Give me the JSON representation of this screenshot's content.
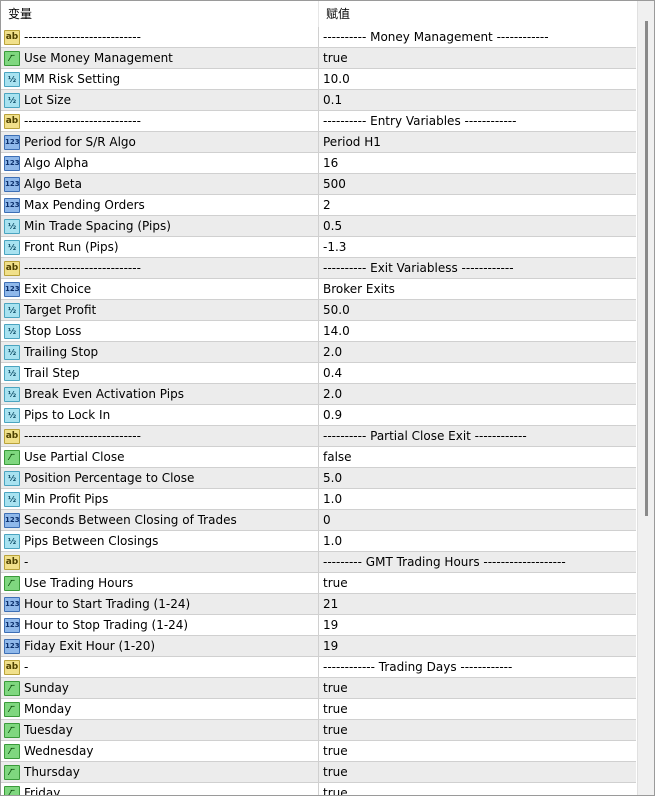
{
  "header": {
    "col_name": "变量",
    "col_value": "赋值"
  },
  "icon_labels": {
    "ab": "ab",
    "bool": "⁄‾",
    "dbl": "½",
    "int": "123"
  },
  "rows": [
    {
      "type": "ab",
      "name": "---------------------------",
      "value": "---------- Money Management ------------"
    },
    {
      "type": "bool",
      "name": "Use Money Management",
      "value": "true"
    },
    {
      "type": "dbl",
      "name": "MM Risk Setting",
      "value": "10.0"
    },
    {
      "type": "dbl",
      "name": "Lot Size",
      "value": "0.1"
    },
    {
      "type": "ab",
      "name": "---------------------------",
      "value": "---------- Entry Variables ------------"
    },
    {
      "type": "int",
      "name": "Period for S/R Algo",
      "value": "Period H1"
    },
    {
      "type": "int",
      "name": "Algo Alpha",
      "value": "16"
    },
    {
      "type": "int",
      "name": "Algo Beta",
      "value": "500"
    },
    {
      "type": "int",
      "name": "Max Pending Orders",
      "value": "2"
    },
    {
      "type": "dbl",
      "name": "Min Trade Spacing (Pips)",
      "value": "0.5"
    },
    {
      "type": "dbl",
      "name": "Front Run (Pips)",
      "value": "-1.3"
    },
    {
      "type": "ab",
      "name": "---------------------------",
      "value": "---------- Exit Variabless ------------"
    },
    {
      "type": "int",
      "name": "Exit Choice",
      "value": "Broker Exits"
    },
    {
      "type": "dbl",
      "name": "Target Profit",
      "value": "50.0"
    },
    {
      "type": "dbl",
      "name": "Stop Loss",
      "value": "14.0"
    },
    {
      "type": "dbl",
      "name": "Trailing Stop",
      "value": "2.0"
    },
    {
      "type": "dbl",
      "name": "Trail Step",
      "value": "0.4"
    },
    {
      "type": "dbl",
      "name": "Break Even Activation Pips",
      "value": "2.0"
    },
    {
      "type": "dbl",
      "name": "Pips to Lock In",
      "value": "0.9"
    },
    {
      "type": "ab",
      "name": "---------------------------",
      "value": "---------- Partial Close Exit ------------"
    },
    {
      "type": "bool",
      "name": "Use Partial Close",
      "value": "false"
    },
    {
      "type": "dbl",
      "name": "Position Percentage to Close",
      "value": "5.0"
    },
    {
      "type": "dbl",
      "name": "Min Profit Pips",
      "value": "1.0"
    },
    {
      "type": "int",
      "name": "Seconds Between Closing of Trades",
      "value": "0"
    },
    {
      "type": "dbl",
      "name": "Pips Between Closings",
      "value": "1.0"
    },
    {
      "type": "ab",
      "name": "-",
      "value": "--------- GMT Trading Hours -------------------"
    },
    {
      "type": "bool",
      "name": "Use Trading Hours",
      "value": "true"
    },
    {
      "type": "int",
      "name": "Hour to Start Trading (1-24)",
      "value": "21"
    },
    {
      "type": "int",
      "name": "Hour to Stop Trading (1-24)",
      "value": "19"
    },
    {
      "type": "int",
      "name": "Fiday Exit Hour (1-20)",
      "value": "19"
    },
    {
      "type": "ab",
      "name": "-",
      "value": "------------ Trading Days ------------"
    },
    {
      "type": "bool",
      "name": "Sunday",
      "value": "true"
    },
    {
      "type": "bool",
      "name": "Monday",
      "value": "true"
    },
    {
      "type": "bool",
      "name": "Tuesday",
      "value": "true"
    },
    {
      "type": "bool",
      "name": "Wednesday",
      "value": "true"
    },
    {
      "type": "bool",
      "name": "Thursday",
      "value": "true"
    },
    {
      "type": "bool",
      "name": "Friday",
      "value": "true"
    }
  ]
}
